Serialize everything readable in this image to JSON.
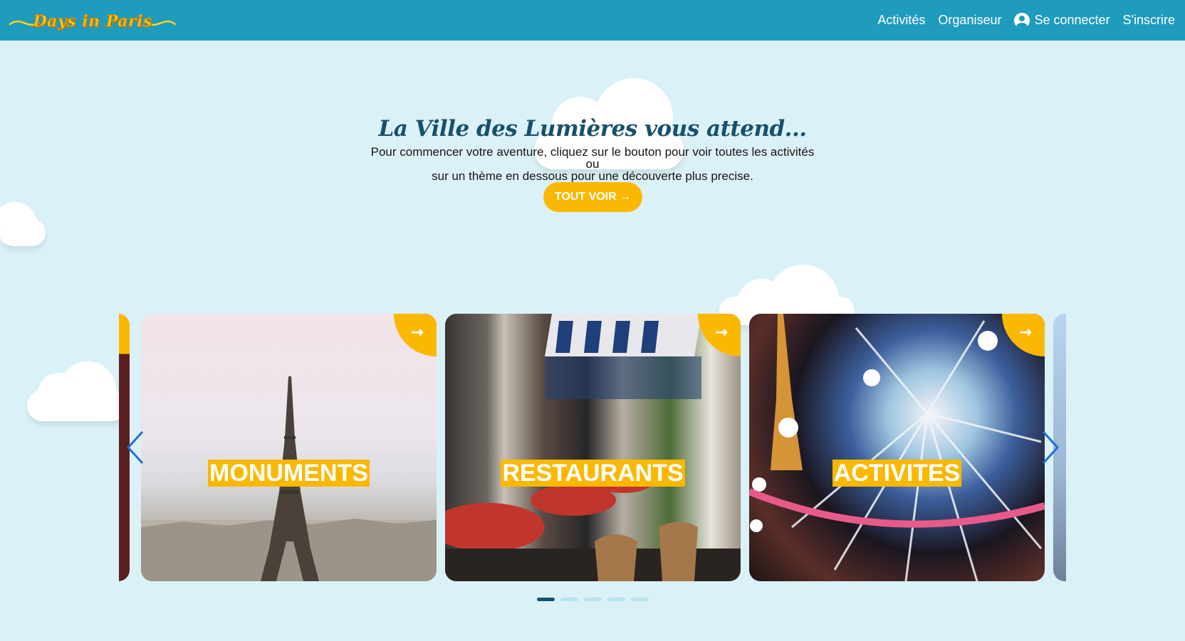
{
  "navbar": {
    "logo": "Days in Paris",
    "links": [
      "Activités",
      "Organiseur",
      "Se connecter",
      "S'inscrire"
    ]
  },
  "hero": {
    "title": "La Ville des Lumières vous attend...",
    "text_line1": "Pour commencer votre aventure, cliquez sur le bouton pour voir toutes les activités ou",
    "text_line2": "sur un thème en dessous pour une découverte plus precise.",
    "cta": "TOUT VOIR →"
  },
  "carousel": {
    "cards": [
      {
        "label": "MONUMENTS"
      },
      {
        "label": "RESTAURANTS"
      },
      {
        "label": "ACTIVITES"
      }
    ],
    "corner_arrow": "→",
    "active_slide": 1,
    "slide_count": 5
  },
  "colors": {
    "navbar": "#1f9bbd",
    "background": "#daf1f7",
    "accent": "#fbb800",
    "title": "#17506b",
    "arrow": "#1e6fd9"
  },
  "icons": [
    "user-circle-icon",
    "chevron-left-icon",
    "chevron-right-icon",
    "arrow-right-icon",
    "cloud-icon"
  ]
}
